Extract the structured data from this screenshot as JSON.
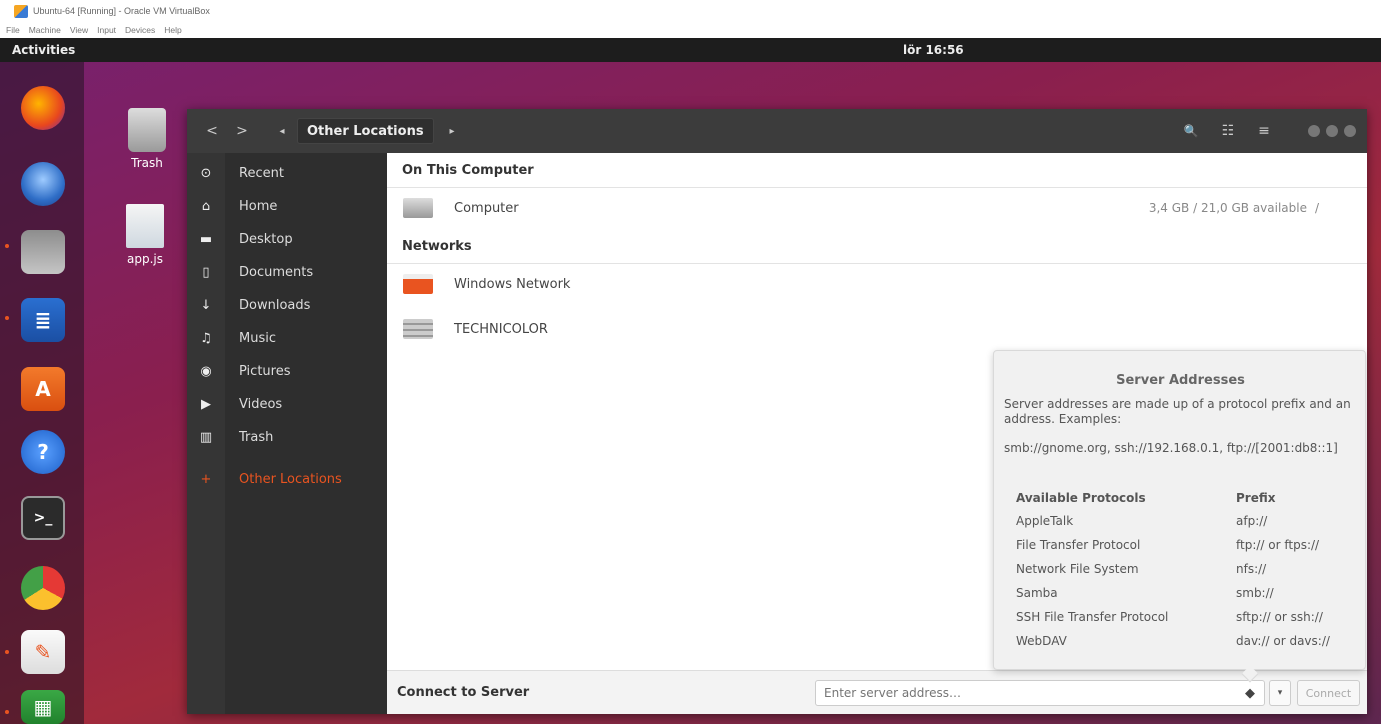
{
  "vbox": {
    "title": "Ubuntu-64 [Running] - Oracle VM VirtualBox",
    "menu": [
      "File",
      "Machine",
      "View",
      "Input",
      "Devices",
      "Help"
    ]
  },
  "topbar": {
    "activities": "Activities",
    "clock": "lör 16:56"
  },
  "dock": [
    "firefox-icon",
    "thunderbird-icon",
    "files-icon",
    "libreoffice-writer-icon",
    "software-center-icon",
    "help-icon",
    "terminal-icon",
    "chrome-icon",
    "text-editor-icon",
    "libreoffice-calc-icon"
  ],
  "desktop": {
    "trash_label": "Trash",
    "app_label": "app.js"
  },
  "headerbar": {
    "back": "<",
    "forward": ">",
    "path_left": "◂",
    "path": "Other Locations",
    "path_right": "▸",
    "search_icon": "🔍",
    "view_icon": "☷",
    "menu_icon": "≡"
  },
  "sidebar": {
    "items": [
      {
        "icon": "⊙",
        "label": "Recent"
      },
      {
        "icon": "⌂",
        "label": "Home"
      },
      {
        "icon": "▬",
        "label": "Desktop"
      },
      {
        "icon": "▯",
        "label": "Documents"
      },
      {
        "icon": "↓",
        "label": "Downloads"
      },
      {
        "icon": "♫",
        "label": "Music"
      },
      {
        "icon": "◉",
        "label": "Pictures"
      },
      {
        "icon": "▶",
        "label": "Videos"
      },
      {
        "icon": "▥",
        "label": "Trash"
      }
    ],
    "other": {
      "icon": "+",
      "label": "Other Locations"
    }
  },
  "content": {
    "on_this_computer": "On This Computer",
    "computer": {
      "label": "Computer",
      "info": "3,4 GB / 21,0 GB available",
      "mount": "/"
    },
    "networks": "Networks",
    "windows_network": "Windows Network",
    "technicolor": "TECHNICOLOR"
  },
  "bottombar": {
    "connect_label": "Connect to Server",
    "address_placeholder": "Enter server address…",
    "help_icon": "◆",
    "dropdown_icon": "▾",
    "connect_button": "Connect"
  },
  "popover": {
    "title": "Server Addresses",
    "description": "Server addresses are made up of a protocol prefix and an address. Examples:",
    "examples": "smb://gnome.org, ssh://192.168.0.1, ftp://[2001:db8::1]",
    "col_protocols": "Available Protocols",
    "col_prefix": "Prefix",
    "rows": [
      {
        "name": "AppleTalk",
        "prefix": "afp://"
      },
      {
        "name": "File Transfer Protocol",
        "prefix": "ftp:// or ftps://"
      },
      {
        "name": "Network File System",
        "prefix": "nfs://"
      },
      {
        "name": "Samba",
        "prefix": "smb://"
      },
      {
        "name": "SSH File Transfer Protocol",
        "prefix": "sftp:// or ssh://"
      },
      {
        "name": "WebDAV",
        "prefix": "dav:// or davs://"
      }
    ]
  },
  "colors": {
    "accent": "#e95420",
    "headerbar": "#3c3c3c",
    "sidebar": "#2e2e2e"
  }
}
